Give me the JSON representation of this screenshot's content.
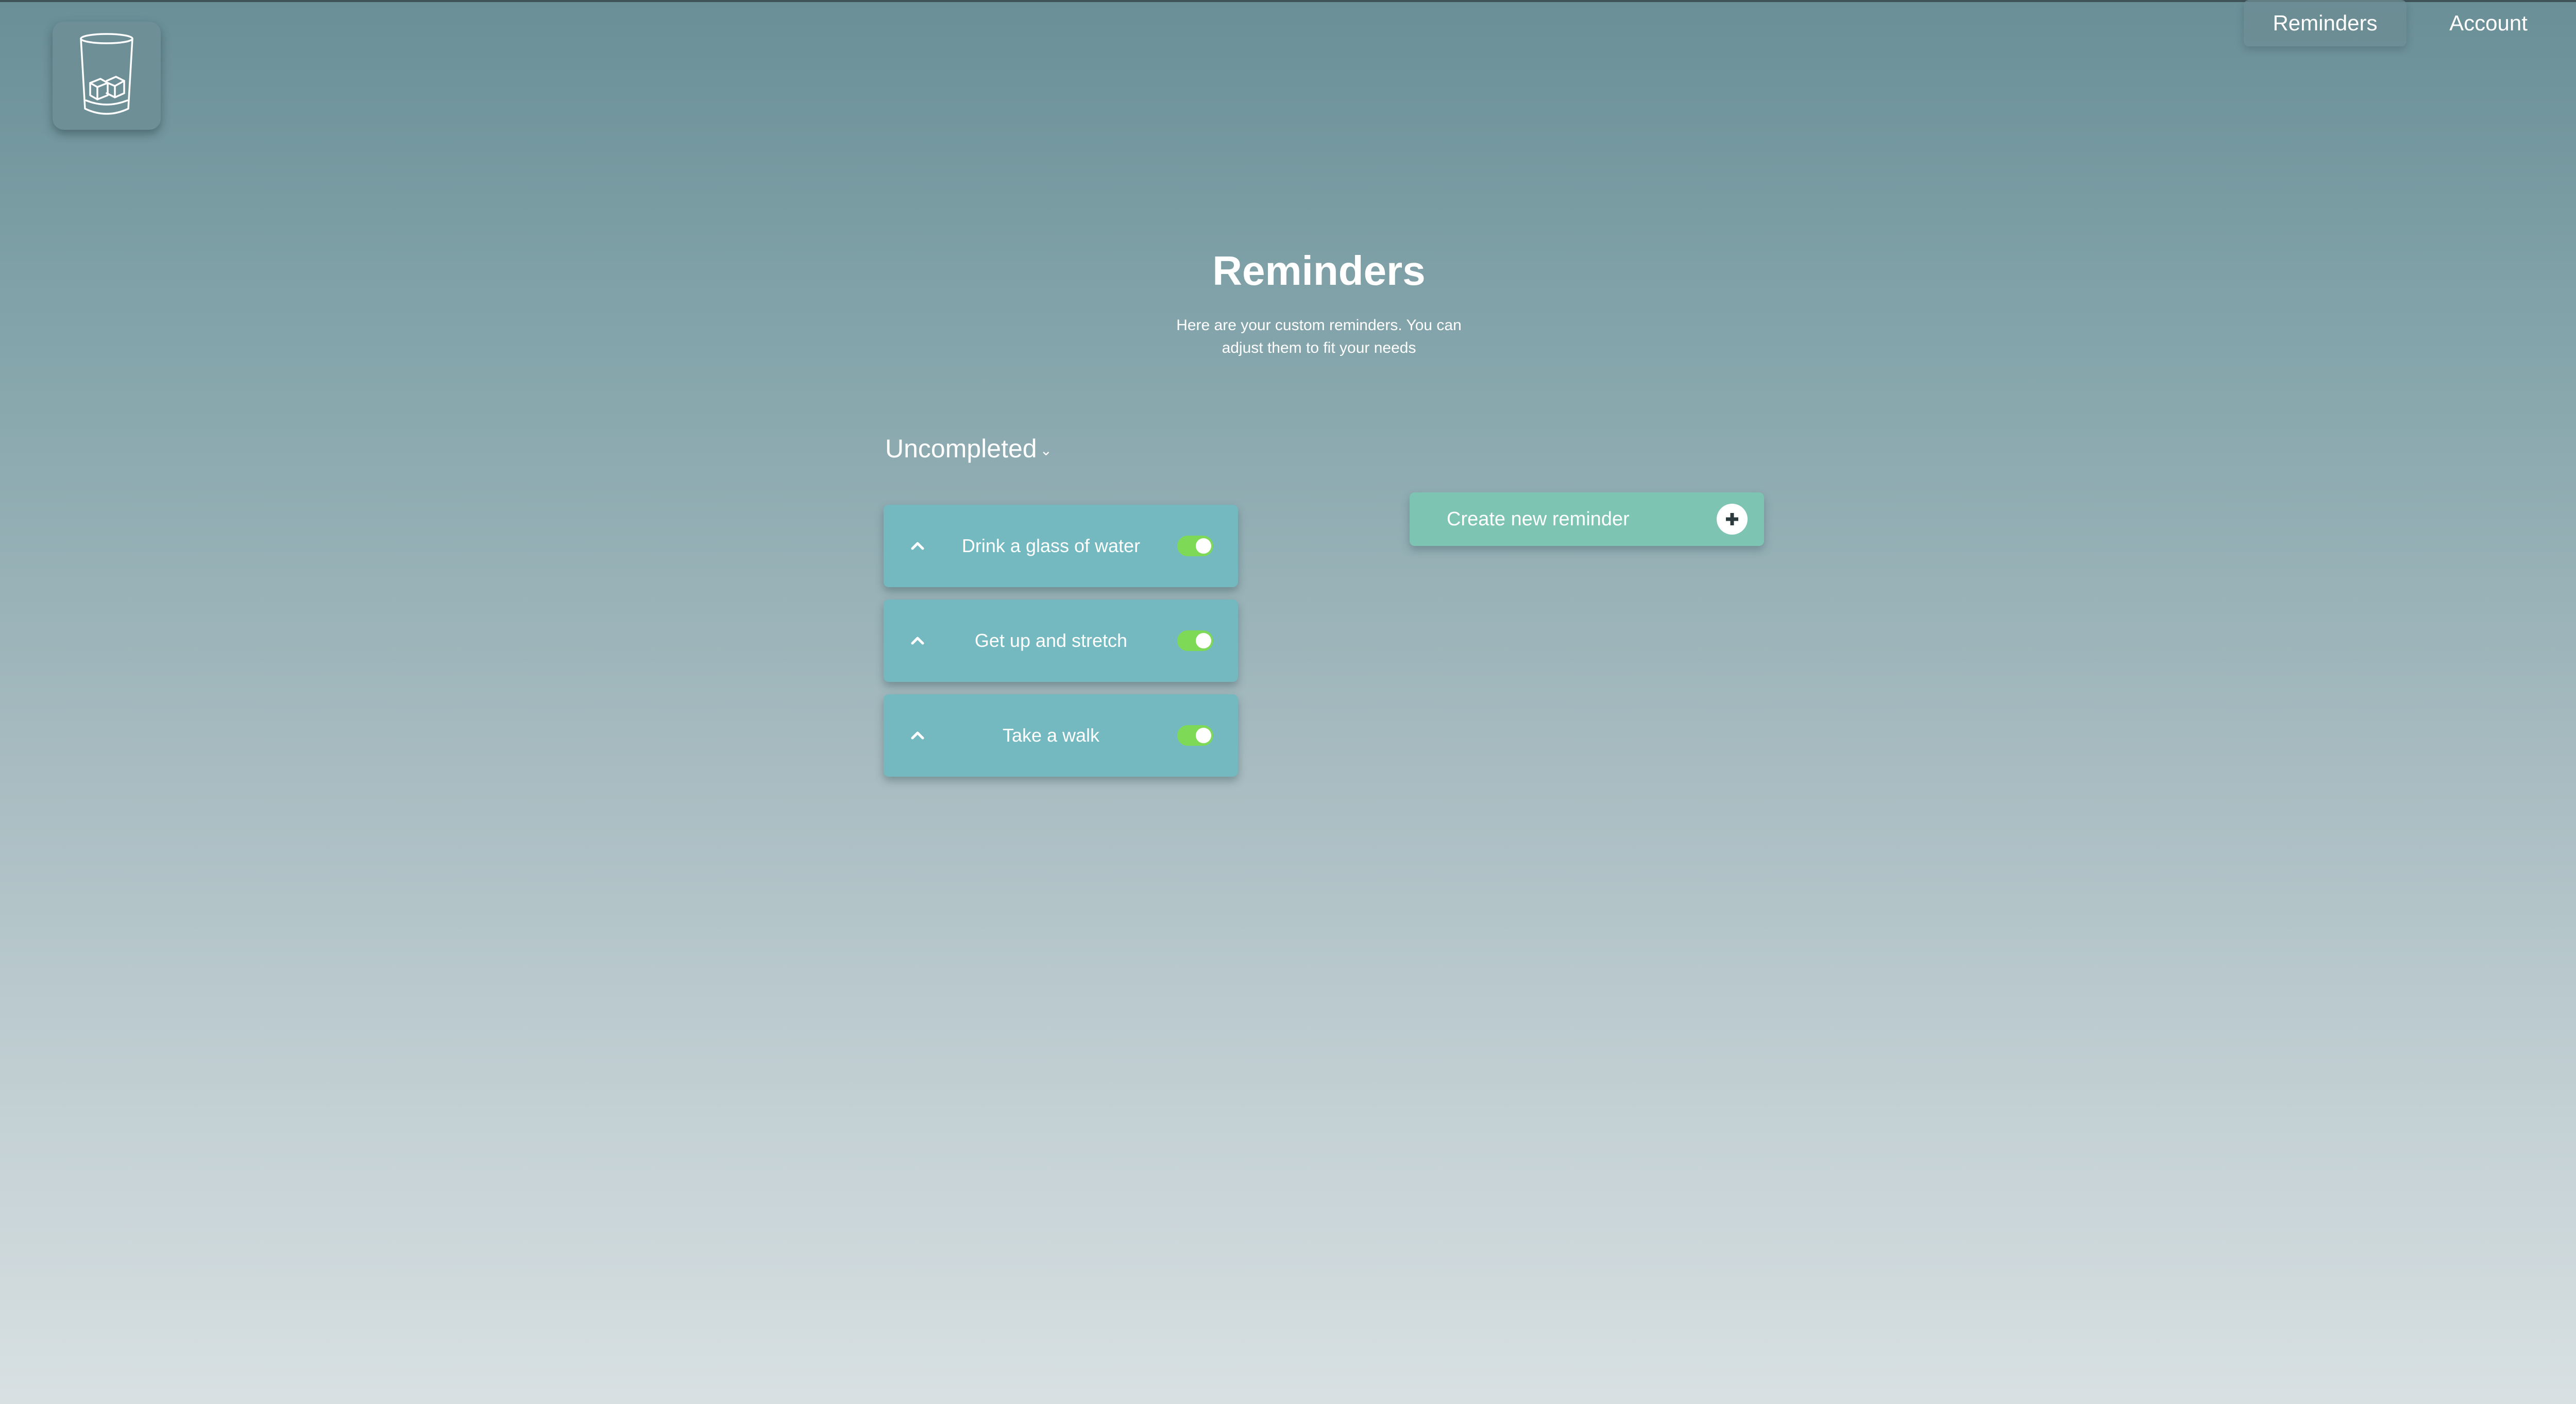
{
  "colors": {
    "card": "#73b9bf",
    "create_button": "#7dc4b2",
    "toggle_on": "#7ed957",
    "text": "#ffffff"
  },
  "logo": {
    "icon": "glass-with-ice-icon"
  },
  "nav": {
    "items": [
      {
        "label": "Reminders",
        "active": true
      },
      {
        "label": "Account",
        "active": false
      }
    ]
  },
  "header": {
    "title": "Reminders",
    "subtitle": "Here are your custom reminders. You can adjust them to fit your needs"
  },
  "filter": {
    "selected": "Uncompleted",
    "icon": "chevron-down-icon"
  },
  "reminders": [
    {
      "title": "Drink a glass of water",
      "enabled": true
    },
    {
      "title": "Get up and stretch",
      "enabled": true
    },
    {
      "title": "Take a walk",
      "enabled": true
    }
  ],
  "create": {
    "label": "Create new reminder",
    "icon": "plus-circle-icon"
  }
}
